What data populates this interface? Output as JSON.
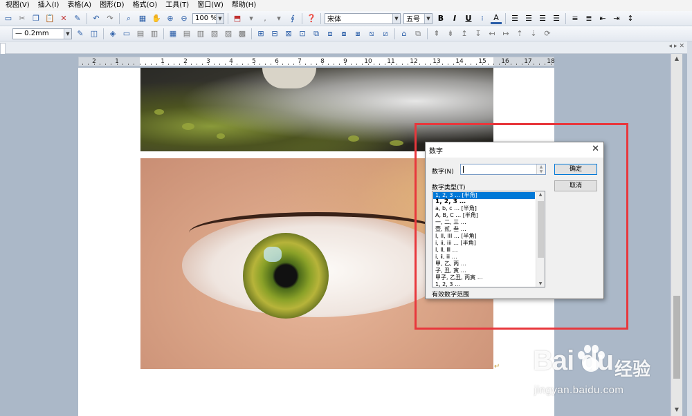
{
  "menubar": {
    "items": [
      "视图(V)",
      "插入(I)",
      "表格(A)",
      "图形(D)",
      "格式(O)",
      "工具(T)",
      "窗口(W)",
      "帮助(H)"
    ]
  },
  "toolbar1": {
    "zoom": "100 %",
    "font_name": "宋体",
    "font_size": "五号",
    "bold": "B",
    "italic": "I",
    "underline": "U",
    "font_color_label": "A"
  },
  "toolbar2": {
    "line_width": "— 0.2mm"
  },
  "ruler": {
    "left_numbers": [
      "2",
      "1"
    ],
    "numbers": [
      "1",
      "2",
      "3",
      "4",
      "5",
      "6",
      "7",
      "8",
      "9",
      "10",
      "11",
      "12",
      "13",
      "14",
      "15",
      "16",
      "17",
      "18"
    ]
  },
  "dialog": {
    "title": "数字",
    "number_label": "数字(N)",
    "number_value": "",
    "type_label": "数字类型(T)",
    "ok": "确定",
    "cancel": "取消",
    "footer": "有效数字范围",
    "types": [
      "1, 2, 3 … [半角]",
      "1, 2, 3 …",
      "a, b, c … [半角]",
      "A, B, C … [半角]",
      "一, 二, 三 …",
      "壹, 贰, 叁 …",
      "I, II, III … [半角]",
      "i, ii, iii … [半角]",
      "Ⅰ, Ⅱ, Ⅲ …",
      "ⅰ, ⅱ, ⅲ …",
      "甲, 乙, 丙 …",
      "子, 丑, 寅 …",
      "甲子, 乙丑, 丙寅 …",
      "1, 2, 3 …"
    ],
    "selected_index": 0
  },
  "watermark": {
    "logo": "Bai  du",
    "cn": "经验",
    "url": "jingyan.baidu.com"
  },
  "colors": {
    "highlight": "#e8373c",
    "selection": "#0078d7"
  }
}
